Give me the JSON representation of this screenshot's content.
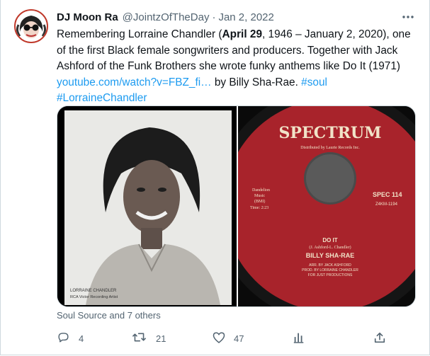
{
  "tweet": {
    "author_name": "DJ Moon Ra",
    "handle": "@JointzOfTheDay",
    "separator": "·",
    "date": "Jan 2, 2022",
    "text_1": "Remembering Lorraine Chandler (",
    "text_bold": "April 29",
    "text_2": ", 1946 – January 2, 2020), one of the first Black female songwriters and producers. Together with Jack Ashford of the Funk Brothers she wrote funky anthems like Do It (1971) ",
    "link_url": "youtube.com/watch?v=FBZ_fi…",
    "text_3": " by Billy Sha-Rae. ",
    "hashtag_1": "#soul",
    "hashtag_2": "#LorraineChandler"
  },
  "media": {
    "photo_caption_line1": "LORRAINE CHANDLER",
    "photo_caption_line2": "RCA Victor Recording Artist",
    "label_brand": "SPECTRUM",
    "label_distributed": "Distributed by Laurie Records Inc.",
    "label_publisher_1": "Dandelion",
    "label_publisher_2": "Music",
    "label_publisher_3": "(BMI)",
    "label_publisher_4": "Time: 2:23",
    "label_catalog": "SPEC 114",
    "label_matrix": "Z4KM-1194",
    "song_title": "DO IT",
    "song_writers": "(J. Ashford-L. Chandler)",
    "song_artist": "BILLY SHA-RAE",
    "song_credit_1": "ARR. BY JACK ASHFORD",
    "song_credit_2": "PROD. BY LORRAINE CHANDLER",
    "song_credit_3": "FOR JUST PRODUCTIONS"
  },
  "social_context": "Soul Source and 7 others",
  "actions": {
    "reply_count": "4",
    "retweet_count": "21",
    "like_count": "47"
  },
  "colors": {
    "link": "#1d9bf0",
    "secondary_text": "#536471",
    "record_label": "#a8232b"
  },
  "icons": [
    "more-icon",
    "reply-icon",
    "retweet-icon",
    "like-icon",
    "views-icon",
    "share-icon"
  ]
}
